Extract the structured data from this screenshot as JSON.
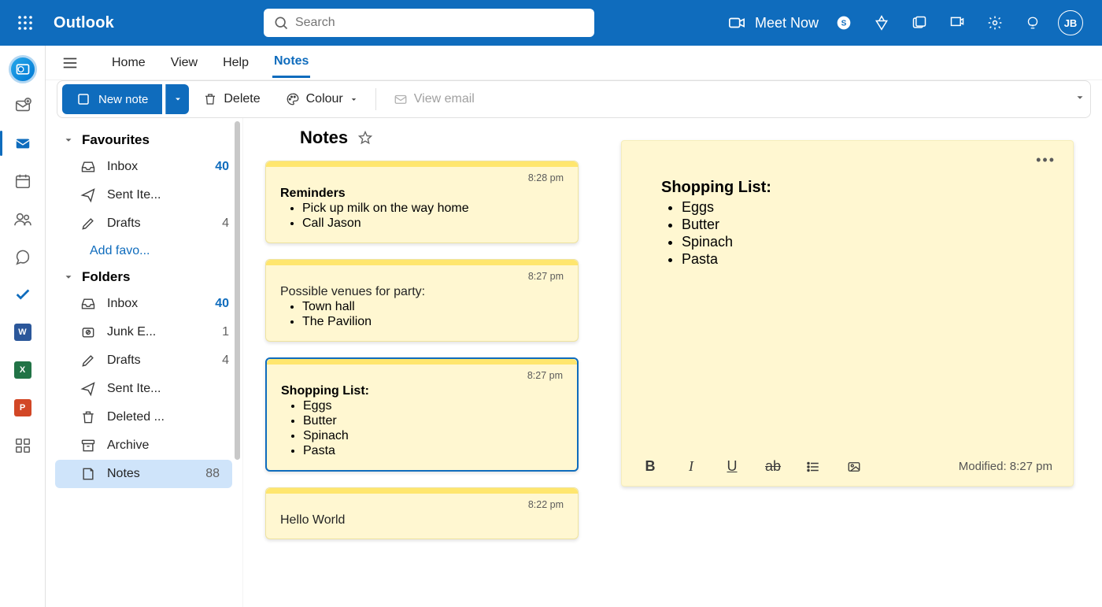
{
  "header": {
    "brand": "Outlook",
    "search_placeholder": "Search",
    "meet_label": "Meet Now",
    "avatar_initials": "JB"
  },
  "tabs": {
    "home": "Home",
    "view": "View",
    "help": "Help",
    "notes": "Notes"
  },
  "toolbar": {
    "new_note": "New note",
    "delete": "Delete",
    "colour": "Colour",
    "view_email": "View email"
  },
  "folders": {
    "favourites_label": "Favourites",
    "folders_label": "Folders",
    "add_favourite": "Add favo...",
    "fav": [
      {
        "label": "Inbox",
        "count": "40",
        "blue": true
      },
      {
        "label": "Sent Ite...",
        "count": ""
      },
      {
        "label": "Drafts",
        "count": "4",
        "blue": false
      }
    ],
    "all": [
      {
        "label": "Inbox",
        "count": "40",
        "blue": true
      },
      {
        "label": "Junk E...",
        "count": "1",
        "blue": false
      },
      {
        "label": "Drafts",
        "count": "4",
        "blue": false
      },
      {
        "label": "Sent Ite...",
        "count": ""
      },
      {
        "label": "Deleted ...",
        "count": ""
      },
      {
        "label": "Archive",
        "count": ""
      },
      {
        "label": "Notes",
        "count": "88",
        "blue": false,
        "selected": true
      }
    ]
  },
  "notes_header": "Notes",
  "notes": [
    {
      "time": "8:28 pm",
      "title": "Reminders",
      "text": "",
      "items": [
        "Pick up milk on the way home",
        "Call Jason"
      ],
      "selected": false
    },
    {
      "time": "8:27 pm",
      "title": "",
      "text": "Possible venues for party:",
      "items": [
        "Town hall",
        "The Pavilion"
      ],
      "selected": false
    },
    {
      "time": "8:27 pm",
      "title": "Shopping List:",
      "text": "",
      "items": [
        "Eggs",
        "Butter",
        "Spinach",
        "Pasta"
      ],
      "selected": true
    },
    {
      "time": "8:22 pm",
      "title": "",
      "text": "Hello World",
      "items": [],
      "selected": false
    }
  ],
  "detail": {
    "title": "Shopping List:",
    "items": [
      "Eggs",
      "Butter",
      "Spinach",
      "Pasta"
    ],
    "modified": "Modified: 8:27 pm"
  }
}
